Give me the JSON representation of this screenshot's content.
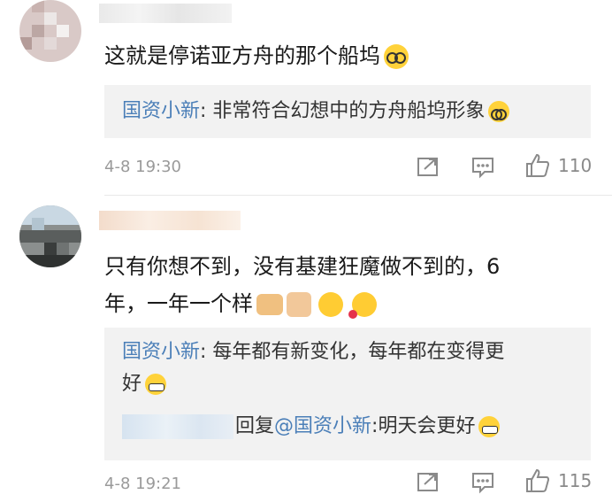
{
  "comments": [
    {
      "text": "这就是停诺亚方舟的那个船坞",
      "replies": [
        {
          "author": "国资小新",
          "sep": ": ",
          "text": "非常符合幻想中的方舟船坞形象"
        }
      ],
      "time": "4-8 19:30",
      "likes": "110"
    },
    {
      "text_line1": "只有你想不到，没有基建狂魔做不到的，6",
      "text_line2": "年，一年一个样",
      "replies": [
        {
          "author": "国资小新",
          "sep": ": ",
          "text_line1": "每年都有新变化，每年都在变得更",
          "text_line2": "好"
        },
        {
          "prefix": "回复",
          "mention": "@国资小新",
          "text": ":明天会更好"
        }
      ],
      "time": "4-8 19:21",
      "likes": "115"
    }
  ],
  "icons": {
    "share": "share-icon",
    "comment": "comment-icon",
    "like": "thumbs-up-icon"
  },
  "colors": {
    "author": "#4b7fb8",
    "meta": "#9a9a9a",
    "reply_bg": "#f2f2f2"
  }
}
